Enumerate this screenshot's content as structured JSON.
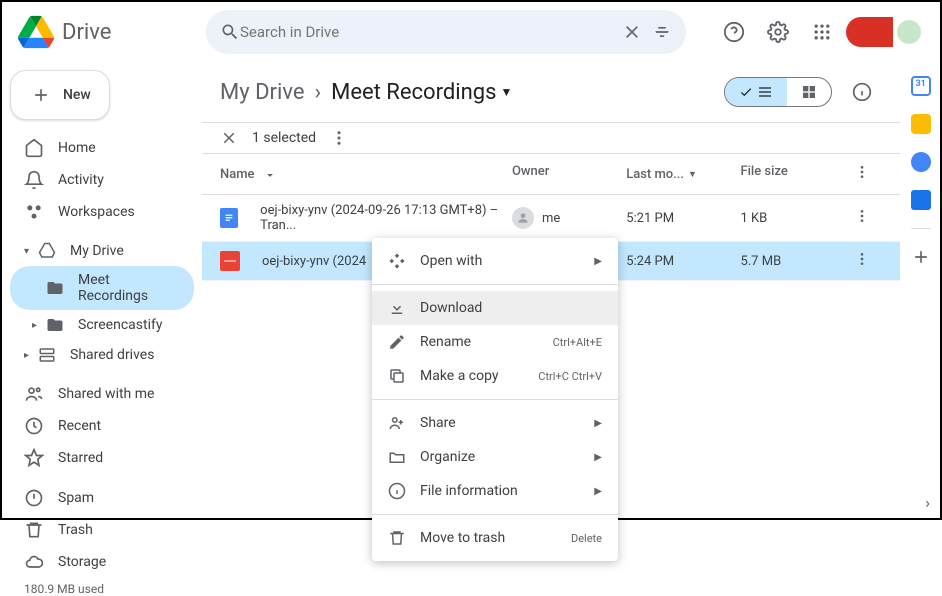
{
  "header": {
    "title": "Drive",
    "search_placeholder": "Search in Drive"
  },
  "sidebar": {
    "new_label": "New",
    "items": [
      {
        "label": "Home"
      },
      {
        "label": "Activity"
      },
      {
        "label": "Workspaces"
      }
    ],
    "my_drive": "My Drive",
    "my_drive_children": [
      {
        "label": "Meet Recordings"
      },
      {
        "label": "Screencastify"
      }
    ],
    "shared_drives": "Shared drives",
    "shared_with_me": "Shared with me",
    "recent": "Recent",
    "starred": "Starred",
    "spam": "Spam",
    "trash": "Trash",
    "storage": "Storage",
    "storage_used": "180.9 MB used"
  },
  "breadcrumb": {
    "root": "My Drive",
    "current": "Meet Recordings"
  },
  "selection": {
    "count_label": "1 selected"
  },
  "columns": {
    "name": "Name",
    "owner": "Owner",
    "modified": "Last mo...",
    "size": "File size"
  },
  "rows": [
    {
      "name": "oej-bixy-ynv (2024-09-26 17:13 GMT+8) – Tran...",
      "owner": "me",
      "modified": "5:21 PM",
      "size": "1 KB",
      "icon": "docs"
    },
    {
      "name": "oej-bixy-ynv (2024",
      "owner": "",
      "modified": "5:24 PM",
      "size": "5.7 MB",
      "icon": "video"
    }
  ],
  "context_menu": {
    "open_with": "Open with",
    "download": "Download",
    "rename": "Rename",
    "rename_shortcut": "Ctrl+Alt+E",
    "make_copy": "Make a copy",
    "make_copy_shortcut": "Ctrl+C Ctrl+V",
    "share": "Share",
    "organize": "Organize",
    "file_info": "File information",
    "move_trash": "Move to trash",
    "delete_label": "Delete"
  }
}
